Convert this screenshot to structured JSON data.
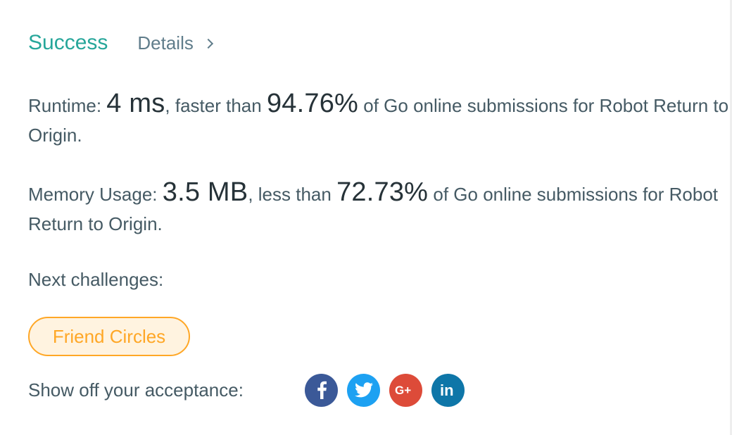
{
  "result": {
    "status": "Success",
    "details_label": "Details"
  },
  "runtime": {
    "label": "Runtime: ",
    "value": "4 ms",
    "mid_text": ", faster than ",
    "percent": "94.76%",
    "suffix": " of Go online submissions for Robot Return to Origin."
  },
  "memory": {
    "label": "Memory Usage: ",
    "value": "3.5 MB",
    "mid_text": ", less than ",
    "percent": "72.73%",
    "suffix": " of Go online submissions for Robot Return to Origin."
  },
  "next": {
    "label": "Next challenges:",
    "challenges": [
      "Friend Circles"
    ]
  },
  "share": {
    "label": "Show off your acceptance:",
    "buttons": [
      {
        "icon": "facebook-icon",
        "color": "#3b5998"
      },
      {
        "icon": "twitter-icon",
        "color": "#1da1f2"
      },
      {
        "icon": "google-plus-icon",
        "color": "#dd4b39"
      },
      {
        "icon": "linkedin-icon",
        "color": "#0e76a8"
      }
    ]
  },
  "colors": {
    "success": "#26a69a",
    "challenge_border": "#ffa726",
    "challenge_bg": "#fff3e0"
  }
}
